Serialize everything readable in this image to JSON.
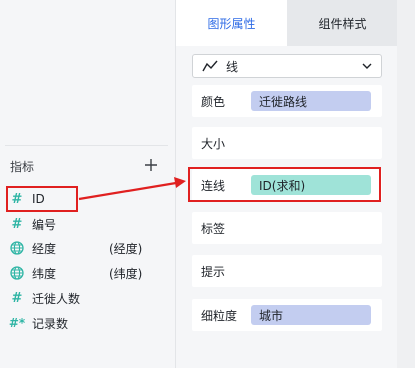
{
  "sidebar": {
    "section_title": "指标",
    "add_icon": "plus-icon",
    "fields": [
      {
        "icon": "#",
        "name": "ID",
        "extra": ""
      },
      {
        "icon": "#",
        "name": "编号",
        "extra": ""
      },
      {
        "icon": "globe",
        "name": "经度",
        "extra": "(经度)"
      },
      {
        "icon": "globe",
        "name": "纬度",
        "extra": "(纬度)"
      },
      {
        "icon": "#",
        "name": "迁徙人数",
        "extra": ""
      },
      {
        "icon": "#*",
        "name": "记录数",
        "extra": ""
      }
    ]
  },
  "panel": {
    "tabs": [
      {
        "label": "图形属性",
        "active": true
      },
      {
        "label": "组件样式",
        "active": false
      }
    ],
    "chart_type": {
      "icon": "line-chart-icon",
      "label": "线"
    },
    "properties": [
      {
        "label": "颜色",
        "value": "迁徙路线",
        "pill": "blue"
      },
      {
        "label": "大小",
        "value": "",
        "pill": ""
      },
      {
        "label": "连线",
        "value": "ID(求和)",
        "pill": "teal"
      },
      {
        "label": "标签",
        "value": "",
        "pill": ""
      },
      {
        "label": "提示",
        "value": "",
        "pill": ""
      },
      {
        "label": "细粒度",
        "value": "城市",
        "pill": "blue"
      }
    ]
  },
  "colors": {
    "accent": "#2e6be6",
    "field_icon": "#2fb5a5",
    "pill_blue": "#c3cdf0",
    "pill_teal": "#9fe3d8",
    "annotation_red": "#e02020"
  }
}
